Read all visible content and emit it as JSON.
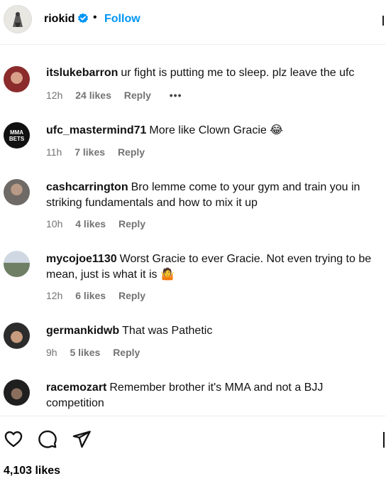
{
  "header": {
    "username": "riokid",
    "separator": "•",
    "follow_label": "Follow"
  },
  "comments": [
    {
      "user": "itslukebarron",
      "text": "ur fight is putting me to sleep. plz leave the ufc",
      "time": "12h",
      "likes": "24 likes",
      "reply": "Reply",
      "more": "•••"
    },
    {
      "user": "ufc_mastermind71",
      "text": "More like Clown Gracie 😂",
      "time": "11h",
      "likes": "7 likes",
      "reply": "Reply",
      "avatar_text": "MMA BETS"
    },
    {
      "user": "cashcarrington",
      "text": "Bro lemme come to your gym and train you in striking fundamentals and how to mix it up",
      "time": "10h",
      "likes": "4 likes",
      "reply": "Reply"
    },
    {
      "user": "mycojoe1130",
      "text": "Worst Gracie to ever Gracie. Not even trying to be mean, just is what it is 🤷",
      "time": "12h",
      "likes": "6 likes",
      "reply": "Reply"
    },
    {
      "user": "germankidwb",
      "text": "That was Pathetic",
      "time": "9h",
      "likes": "5 likes",
      "reply": "Reply"
    },
    {
      "user": "racemozart",
      "text": "Remember brother it's MMA and not a BJJ competition",
      "time": "",
      "likes": "",
      "reply": ""
    }
  ],
  "footer": {
    "likes_count": "4,103 likes"
  },
  "colors": {
    "accent": "#0095f6",
    "meta_text": "#737373"
  },
  "icons": [
    "verified-badge-icon",
    "heart-icon",
    "comment-icon",
    "share-icon",
    "more-options-icon"
  ]
}
